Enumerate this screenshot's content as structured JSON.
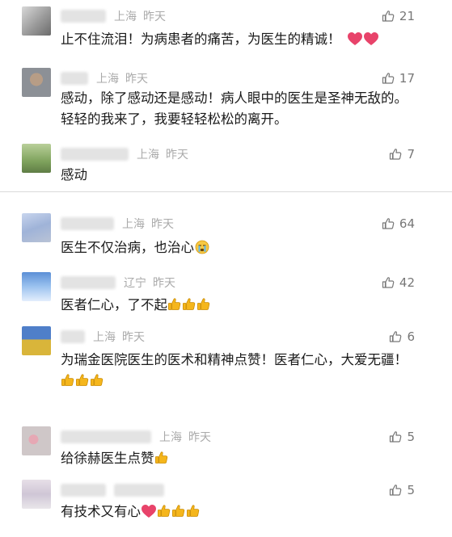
{
  "comments_top": [
    {
      "location": "上海",
      "time": "昨天",
      "likes": "21",
      "text": "止不住流泪！为病患者的痛苦，为医生的精诚！",
      "suffix_icons": [
        "heart-icon",
        "heart-icon"
      ]
    },
    {
      "location": "上海",
      "time": "昨天",
      "likes": "17",
      "text": "感动，除了感动还是感动！病人眼中的医生是圣神无敌的。轻轻的我来了，我要轻轻松松的离开。",
      "suffix_icons": []
    },
    {
      "location": "上海",
      "time": "昨天",
      "likes": "7",
      "text": "感动",
      "suffix_icons": []
    }
  ],
  "comments_bottom": [
    {
      "location": "上海",
      "time": "昨天",
      "likes": "64",
      "text": "医生不仅治病，也治心",
      "suffix_icons": [
        "crying-face-icon"
      ]
    },
    {
      "location": "辽宁",
      "time": "昨天",
      "likes": "42",
      "text": "医者仁心，了不起",
      "suffix_icons": [
        "thumbs-up-icon",
        "thumbs-up-icon",
        "thumbs-up-icon"
      ]
    },
    {
      "location": "上海",
      "time": "昨天",
      "likes": "6",
      "text": "为瑞金医院医生的医术和精神点赞！医者仁心，大爱无疆！",
      "suffix_icons": [
        "thumbs-up-icon",
        "thumbs-up-icon",
        "thumbs-up-icon"
      ]
    },
    {
      "location": "上海",
      "time": "昨天",
      "likes": "5",
      "text": "给徐赫医生点赞",
      "suffix_icons": [
        "thumbs-up-icon"
      ]
    },
    {
      "location": "",
      "time": "",
      "likes": "5",
      "text": "有技术又有心",
      "suffix_icons": [
        "heart-icon",
        "thumbs-up-icon",
        "thumbs-up-icon",
        "thumbs-up-icon"
      ]
    }
  ],
  "colors": {
    "meta_gray": "#aaaaaa",
    "heart_pink": "#e8436a",
    "thumb_yellow": "#f5b61c",
    "separator": "#d9d9d9"
  }
}
